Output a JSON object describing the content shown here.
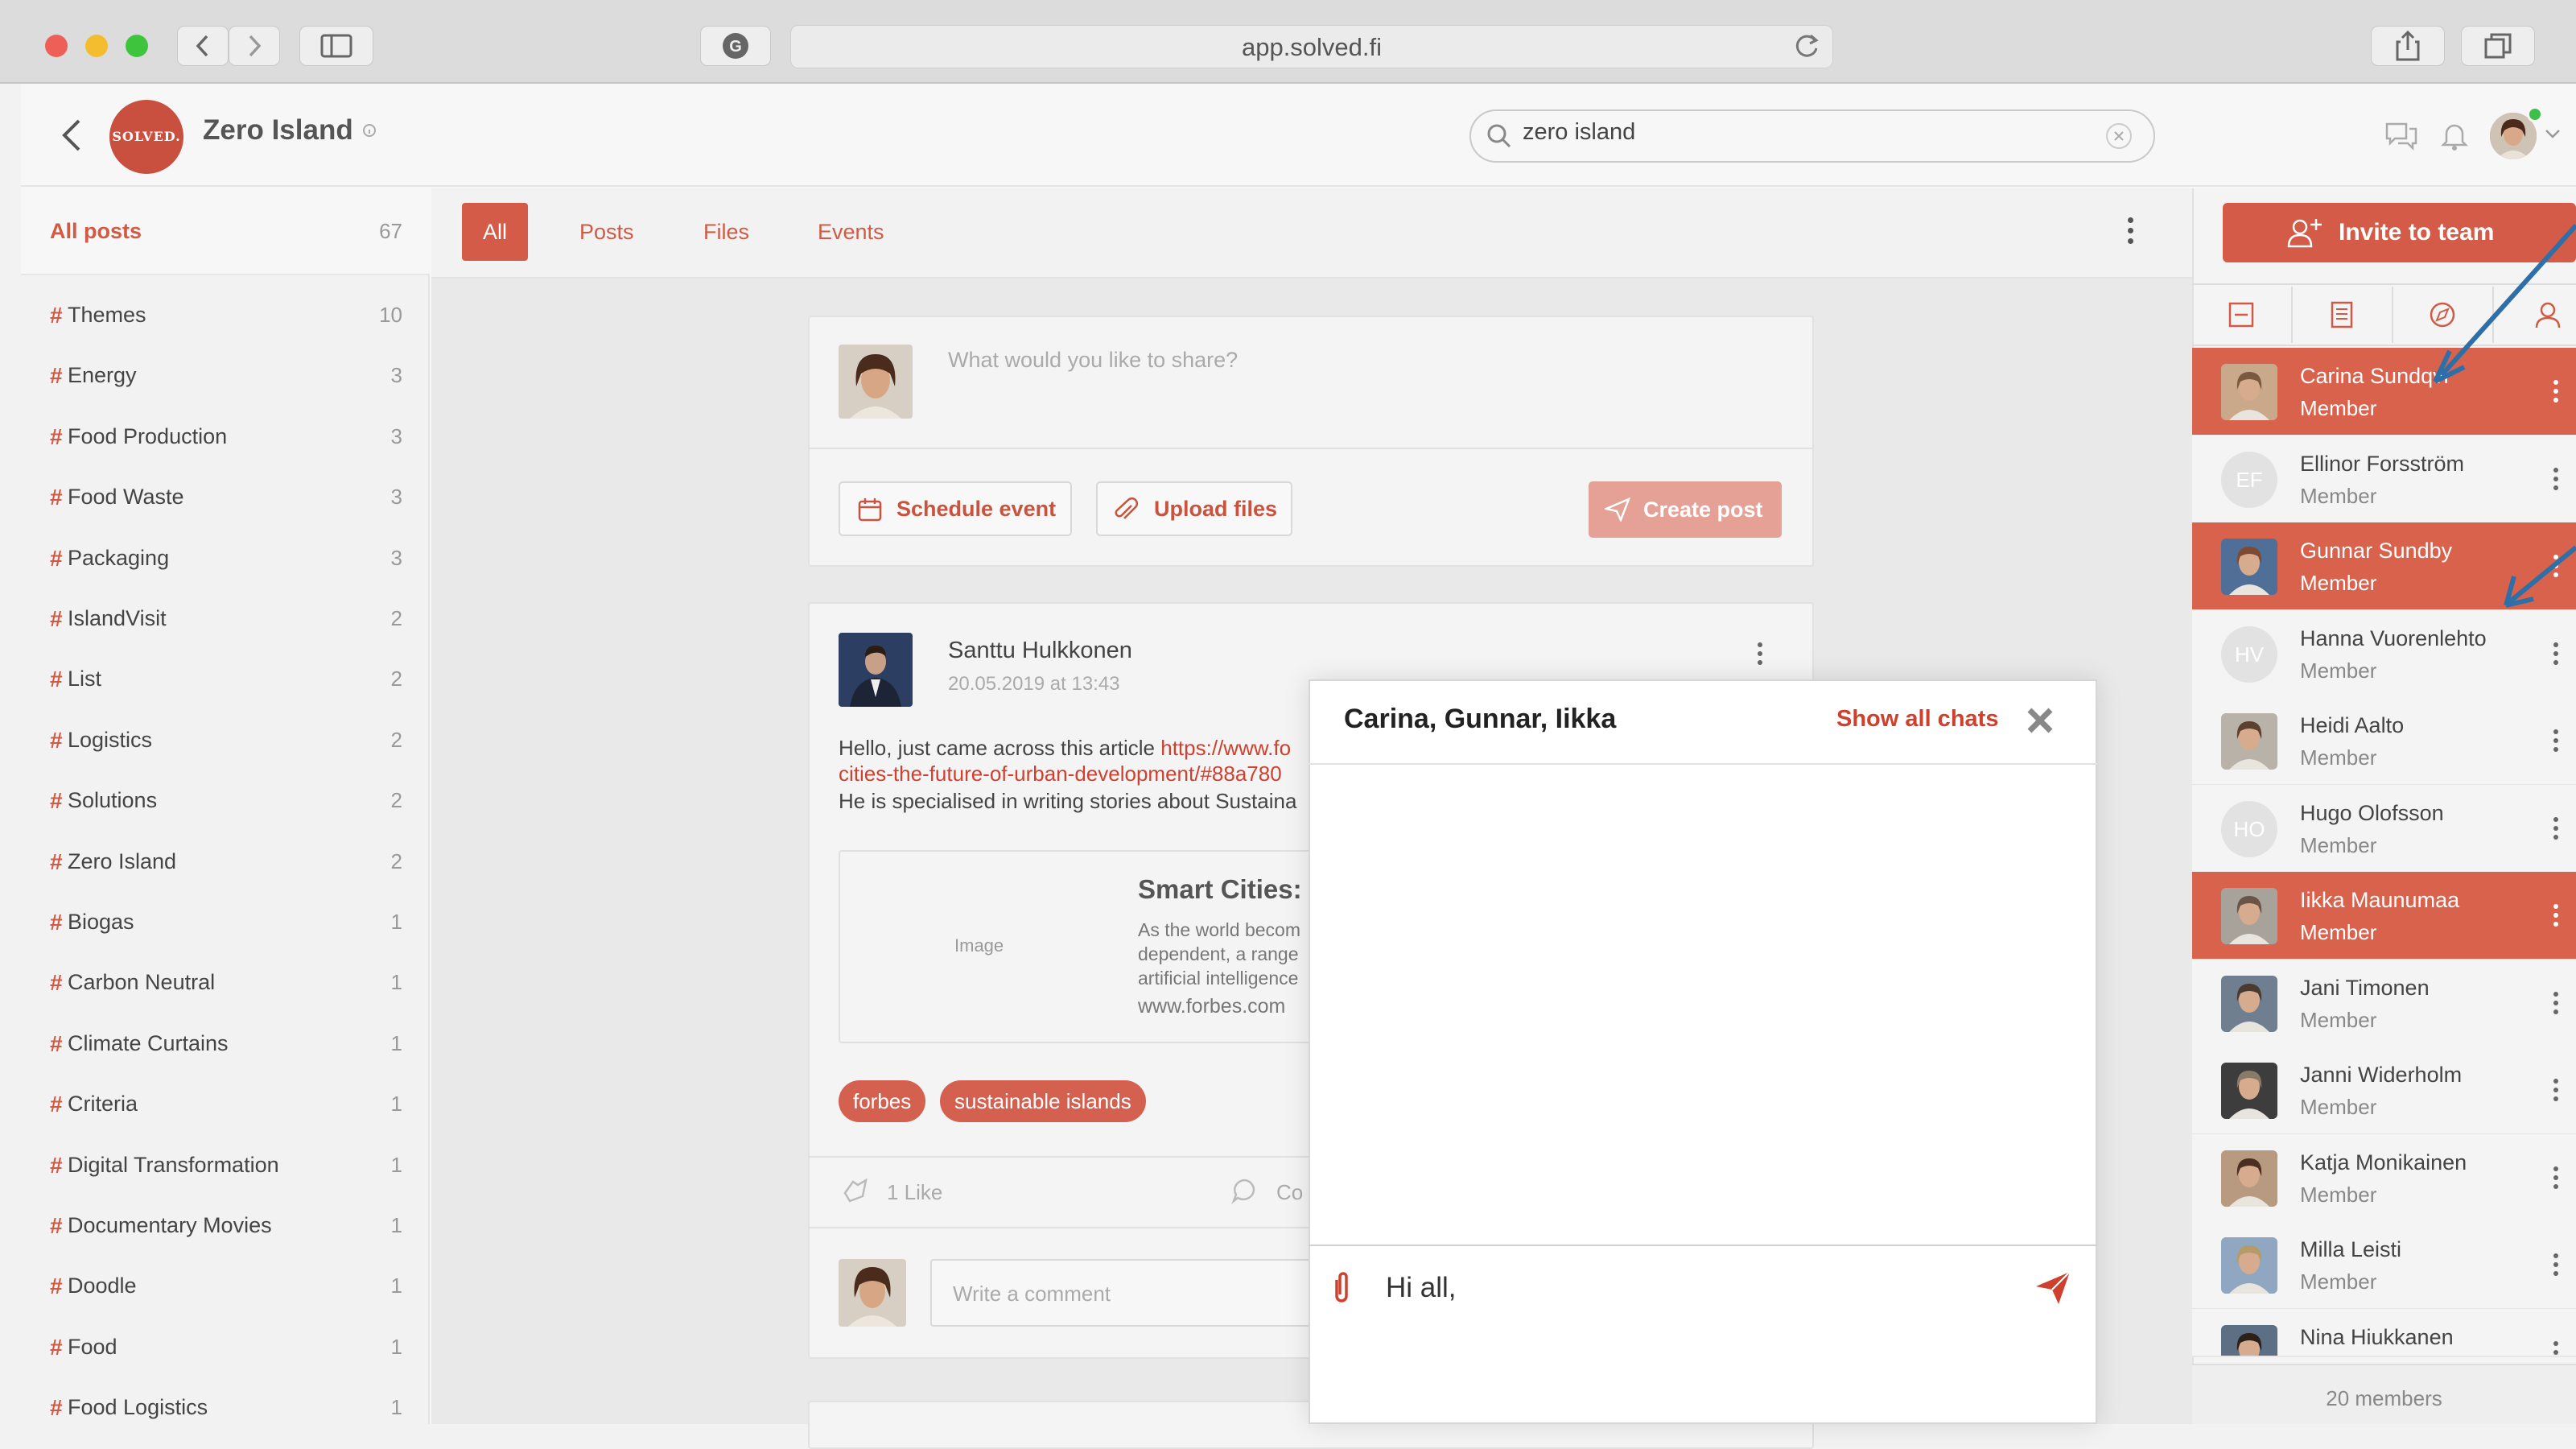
{
  "browser": {
    "url": "app.solved.fi"
  },
  "header": {
    "team_logo_text": "SOLVED.",
    "team_name": "Zero Island",
    "search_value": "zero island"
  },
  "sidebar": {
    "all_posts_label": "All posts",
    "all_posts_count": "67",
    "tags": [
      {
        "name": "Themes",
        "count": "10"
      },
      {
        "name": "Energy",
        "count": "3"
      },
      {
        "name": "Food Production",
        "count": "3"
      },
      {
        "name": "Food Waste",
        "count": "3"
      },
      {
        "name": "Packaging",
        "count": "3"
      },
      {
        "name": "IslandVisit",
        "count": "2"
      },
      {
        "name": "List",
        "count": "2"
      },
      {
        "name": "Logistics",
        "count": "2"
      },
      {
        "name": "Solutions",
        "count": "2"
      },
      {
        "name": "Zero Island",
        "count": "2"
      },
      {
        "name": "Biogas",
        "count": "1"
      },
      {
        "name": "Carbon Neutral",
        "count": "1"
      },
      {
        "name": "Climate Curtains",
        "count": "1"
      },
      {
        "name": "Criteria",
        "count": "1"
      },
      {
        "name": "Digital Transformation",
        "count": "1"
      },
      {
        "name": "Documentary Movies",
        "count": "1"
      },
      {
        "name": "Doodle",
        "count": "1"
      },
      {
        "name": "Food",
        "count": "1"
      },
      {
        "name": "Food Logistics",
        "count": "1"
      }
    ]
  },
  "main": {
    "tabs": [
      "All",
      "Posts",
      "Files",
      "Events"
    ],
    "active_tab": "All",
    "composer": {
      "placeholder": "What would you like to share?",
      "schedule_label": "Schedule event",
      "upload_label": "Upload files",
      "create_label": "Create post"
    },
    "post": {
      "author": "Santtu Hulkkonen",
      "date": "20.05.2019 at 13:43",
      "text_prefix": "Hello, just came across this article ",
      "link_line1": "https://www.fo",
      "link_line2": "cities-the-future-of-urban-development/#88a780",
      "text_line3": "He is specialised in writing stories about Sustaina",
      "preview": {
        "image_label": "Image",
        "title": "Smart Cities: T",
        "desc_line1": "As the world becom",
        "desc_line2": "dependent, a range",
        "desc_line3": "artificial intelligence",
        "site": "www.forbes.com"
      },
      "tags": [
        "forbes",
        "sustainable islands"
      ],
      "likes": "1 Like",
      "comments_label": "Co",
      "comment_placeholder": "Write a comment"
    }
  },
  "right_panel": {
    "invite_label": "Invite to team",
    "members": [
      {
        "name": "Carina Sundqvi",
        "role": "Member",
        "initials": "",
        "selected": true
      },
      {
        "name": "Ellinor Forsström",
        "role": "Member",
        "initials": "EF",
        "selected": false
      },
      {
        "name": "Gunnar Sundby",
        "role": "Member",
        "initials": "",
        "selected": true
      },
      {
        "name": "Hanna Vuorenlehto",
        "role": "Member",
        "initials": "HV",
        "selected": false
      },
      {
        "name": "Heidi Aalto",
        "role": "Member",
        "initials": "",
        "selected": false
      },
      {
        "name": "Hugo Olofsson",
        "role": "Member",
        "initials": "HO",
        "selected": false
      },
      {
        "name": "Iikka Maunumaa",
        "role": "Member",
        "initials": "",
        "selected": true
      },
      {
        "name": "Jani Timonen",
        "role": "Member",
        "initials": "",
        "selected": false
      },
      {
        "name": "Janni Widerholm",
        "role": "Member",
        "initials": "",
        "selected": false
      },
      {
        "name": "Katja Monikainen",
        "role": "Member",
        "initials": "",
        "selected": false
      },
      {
        "name": "Milla Leisti",
        "role": "Member",
        "initials": "",
        "selected": false
      },
      {
        "name": "Nina Hiukkanen",
        "role": "",
        "initials": "",
        "selected": false
      }
    ],
    "member_count": "20 members"
  },
  "chat": {
    "title": "Carina, Gunnar, Iikka",
    "show_all_label": "Show all chats",
    "message_value": "Hi all,"
  },
  "colors": {
    "accent": "#d35b47",
    "link": "#d0402f"
  }
}
